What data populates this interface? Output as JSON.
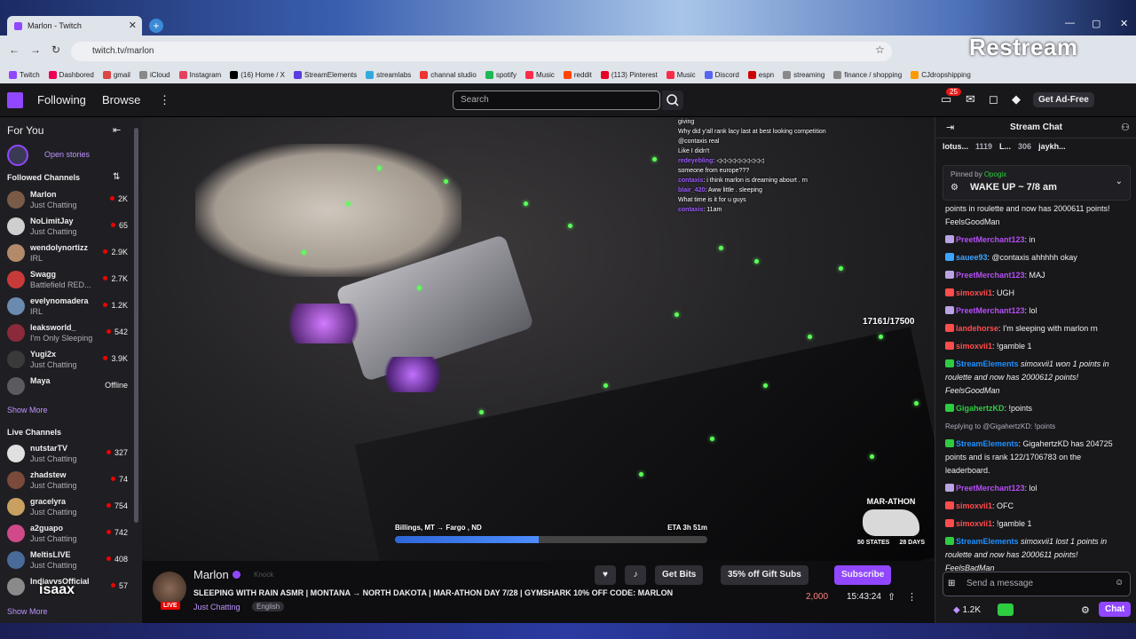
{
  "browser": {
    "tab_title": "Marlon - Twitch",
    "url": "twitch.tv/marlon",
    "overlay_brand": "Restream",
    "bookmarks": [
      "Twitch",
      "Dashbored",
      "gmail",
      "iCloud",
      "Instagram",
      "(16) Home / X",
      "StreamElements",
      "streamlabs",
      "channal studio",
      "spotify",
      "Music",
      "reddit",
      "(113) Pinterest",
      "Music",
      "Discord",
      "espn",
      "streaming",
      "finance / shopping",
      "CJdropshipping"
    ]
  },
  "topbar": {
    "following": "Following",
    "browse": "Browse",
    "search_placeholder": "Search",
    "notif_count": "25",
    "ad_free": "Get Ad-Free"
  },
  "sidebar": {
    "for_you": "For You",
    "open_stories": "Open stories",
    "followed_title": "Followed Channels",
    "followed": [
      {
        "name": "Marlon",
        "cat": "Just Chatting",
        "viewers": "2K",
        "color": "#7a5b48"
      },
      {
        "name": "NoLimitJay",
        "cat": "Just Chatting",
        "viewers": "65",
        "color": "#cfcfcf"
      },
      {
        "name": "wendolynortizz",
        "cat": "IRL",
        "viewers": "2.9K",
        "color": "#b38a6a"
      },
      {
        "name": "Swagg",
        "cat": "Battlefield RED...",
        "viewers": "2.7K",
        "color": "#c83a3a"
      },
      {
        "name": "evelynomadera",
        "cat": "IRL",
        "viewers": "1.2K",
        "color": "#6a8ab0"
      },
      {
        "name": "leaksworld_",
        "cat": "I'm Only Sleeping",
        "viewers": "542",
        "color": "#8a2a3a"
      },
      {
        "name": "Yugi2x",
        "cat": "Just Chatting",
        "viewers": "3.9K",
        "color": "#3a3a3a"
      },
      {
        "name": "Maya",
        "cat": "",
        "viewers": "Offline",
        "color": "#5a5a60"
      }
    ],
    "show_more": "Show More",
    "live_title": "Live Channels",
    "live": [
      {
        "name": "nutstarTV",
        "cat": "Just Chatting",
        "viewers": "327",
        "color": "#e0e0e0"
      },
      {
        "name": "zhadstew",
        "cat": "Just Chatting",
        "viewers": "74",
        "color": "#7a4a3a"
      },
      {
        "name": "gracelyra",
        "cat": "Just Chatting",
        "viewers": "754",
        "color": "#c9a060"
      },
      {
        "name": "a2guapo",
        "cat": "Just Chatting",
        "viewers": "742",
        "color": "#d04a8a"
      },
      {
        "name": "MeltisLIVE",
        "cat": "Just Chatting",
        "viewers": "408",
        "color": "#4a6a9a"
      },
      {
        "name": "IndiavvsOfficial",
        "cat": "",
        "viewers": "57",
        "color": "#8a8a8a"
      }
    ],
    "show_more2": "Show More"
  },
  "overlay_chat": [
    {
      "user": "",
      "text": "giving"
    },
    {
      "user": "",
      "text": "Why did y'all rank lacy last at best looking competition"
    },
    {
      "user": "",
      "text": "@contaxis real"
    },
    {
      "user": "",
      "text": "Like I didn't"
    },
    {
      "user": "redeyebling",
      "text": "◁◁◁◁◁◁◁◁◁◁"
    },
    {
      "user": "",
      "text": "someone from europe???"
    },
    {
      "user": "contaxis",
      "text": "i think marlon is dreaming abourt . rn"
    },
    {
      "user": "blair_420",
      "text": "Aww little . sleeping"
    },
    {
      "user": "",
      "text": "What time is it for u guys"
    },
    {
      "user": "contaxis",
      "text": "11am"
    }
  ],
  "video": {
    "counter": "17161/17500",
    "trip_from": "Billings, MT → Fargo , ND",
    "trip_eta": "ETA 3h 51m",
    "trip_progress": 0.46,
    "marathon_title": "MAR-ATHON",
    "states": "50 STATES",
    "days": "28 DAYS"
  },
  "info": {
    "streamer": "Marlon",
    "knock": "Knock",
    "live": "LIVE",
    "title": "SLEEPING WITH RAIN ASMR | MONTANA → NORTH DAKOTA | MAR-ATHON DAY 7/28 | GYMSHARK 10% OFF CODE: MARLON",
    "category": "Just Chatting",
    "language": "English",
    "get_bits": "Get Bits",
    "gift_subs": "35% off Gift Subs",
    "subscribe": "Subscribe",
    "viewers": "2,000",
    "uptime": "15:43:24",
    "watermark": "isaax"
  },
  "chat": {
    "header": "Stream Chat",
    "leaders": [
      "lotus...",
      "1119",
      "L...",
      "306",
      "jaykh..."
    ],
    "pinned_by": "Pinned by",
    "pinned_user": "Opogix",
    "pinned_msg": "WAKE UP ~ 7/8 am",
    "messages": [
      {
        "cls": "plain",
        "user": "",
        "text": "points in roulette and now has 2000611 points! FeelsGoodMan"
      },
      {
        "cls": "uP",
        "user": "PreetMerchant123",
        "text": ": in"
      },
      {
        "cls": "uB",
        "user": "sauee93",
        "text": ": @contaxis ahhhhh okay"
      },
      {
        "cls": "uP",
        "user": "PreetMerchant123",
        "text": ": MAJ"
      },
      {
        "cls": "uR",
        "user": "simoxvii1",
        "text": ": UGH"
      },
      {
        "cls": "uP",
        "user": "PreetMerchant123",
        "text": ": lol"
      },
      {
        "cls": "uR",
        "user": "landehorse",
        "text": ": I'm sleeping with marlon rn"
      },
      {
        "cls": "uR",
        "user": "simoxvii1",
        "text": ": !gamble 1"
      },
      {
        "cls": "uS",
        "user": "StreamElements",
        "text": " simoxvii1 won 1 points in roulette and now has 2000612 points! FeelsGoodMan"
      },
      {
        "cls": "uG",
        "user": "GigahertzKD",
        "text": ": !points"
      },
      {
        "cls": "reply",
        "user": "",
        "text": "Replying to @GigahertzKD: !points"
      },
      {
        "cls": "uS",
        "user": "StreamElements",
        "text": ": GigahertzKD has 204725 points and is rank 122/1706783 on the leaderboard."
      },
      {
        "cls": "uP",
        "user": "PreetMerchant123",
        "text": ": lol"
      },
      {
        "cls": "uR",
        "user": "simoxvii1",
        "text": ": OFC"
      },
      {
        "cls": "uR",
        "user": "simoxvii1",
        "text": ": !gamble 1"
      },
      {
        "cls": "uS",
        "user": "StreamElements",
        "text": " simoxvii1 lost 1 points in roulette and now has 2000611 points! FeelsBadMan"
      }
    ],
    "input_placeholder": "Send a message",
    "points": "1.2K",
    "chat_btn": "Chat"
  }
}
